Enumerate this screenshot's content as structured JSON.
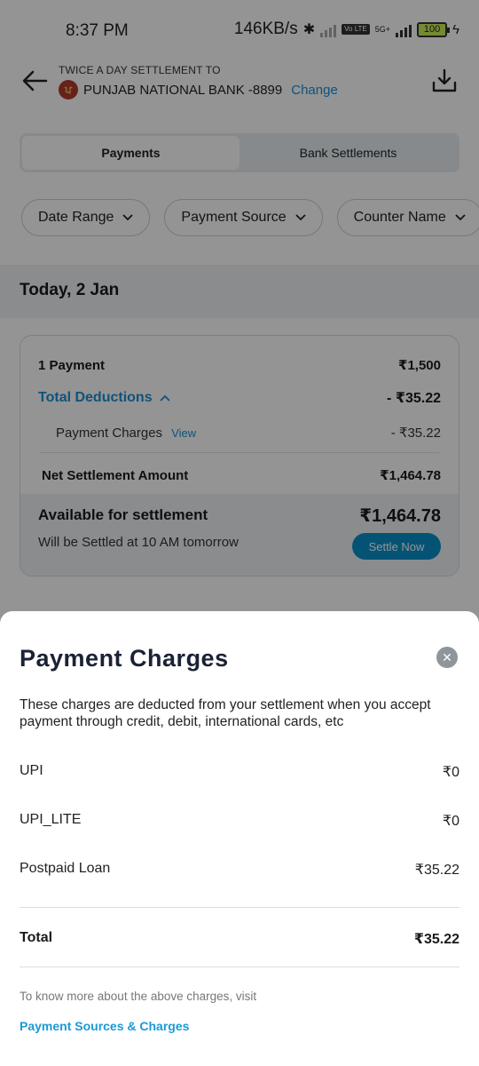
{
  "status_bar": {
    "time": "8:37 PM",
    "speed": "146KB/s",
    "volte": "Vo LTE",
    "network": "5G+",
    "battery": "100"
  },
  "header": {
    "subtitle": "TWICE A DAY SETTLEMENT TO",
    "bank_name": "PUNJAB NATIONAL BANK -8899",
    "change_label": "Change"
  },
  "tabs": [
    {
      "label": "Payments",
      "active": true
    },
    {
      "label": "Bank Settlements",
      "active": false
    }
  ],
  "filters": [
    {
      "label": "Date Range"
    },
    {
      "label": "Payment Source"
    },
    {
      "label": "Counter Name"
    }
  ],
  "date_label": "Today, 2 Jan",
  "summary": {
    "payments_label": "1 Payment",
    "payments_amount": "₹1,500",
    "deductions_label": "Total Deductions",
    "deductions_amount": "- ₹35.22",
    "charges_label": "Payment Charges",
    "view_label": "View",
    "charges_amount": "- ₹35.22",
    "net_label": "Net Settlement Amount",
    "net_amount": "₹1,464.78",
    "available_label": "Available for settlement",
    "available_amount": "₹1,464.78",
    "settle_time": "Will be Settled at 10 AM tomorrow",
    "settle_button": "Settle Now"
  },
  "sheet": {
    "title": "Payment Charges",
    "description": "These charges are deducted from your settlement when you accept payment through credit, debit, international cards, etc",
    "charges": [
      {
        "name": "UPI",
        "amount": "₹0"
      },
      {
        "name": "UPI_LITE",
        "amount": "₹0"
      },
      {
        "name": "Postpaid Loan",
        "amount": "₹35.22"
      }
    ],
    "total_label": "Total",
    "total_amount": "₹35.22",
    "know_more": "To know more about the above charges, visit",
    "link_label": "Payment Sources & Charges"
  },
  "colors": {
    "accent": "#1a8fd8",
    "button": "#0a8fc9",
    "title": "#1b2236"
  }
}
